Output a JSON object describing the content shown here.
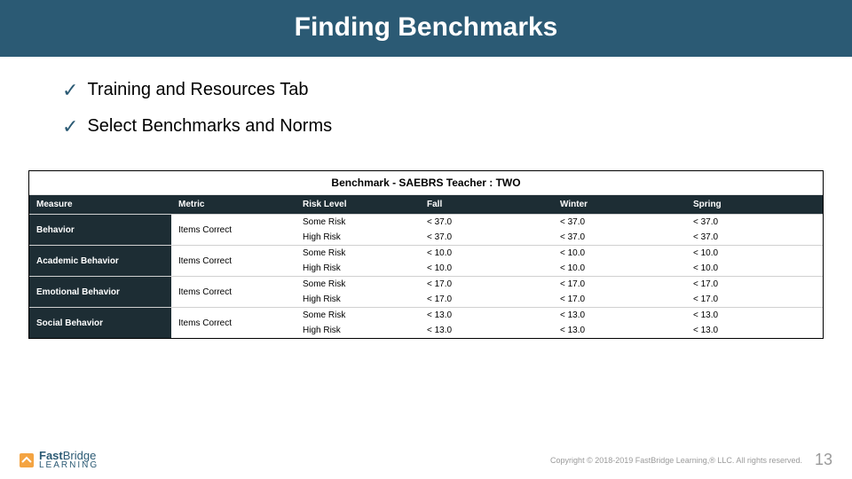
{
  "title": "Finding Benchmarks",
  "bullets": [
    "Training and Resources Tab",
    "Select Benchmarks and Norms"
  ],
  "table": {
    "title": "Benchmark - SAEBRS Teacher : TWO",
    "headers": [
      "Measure",
      "Metric",
      "Risk Level",
      "Fall",
      "Winter",
      "Spring"
    ],
    "rows": [
      {
        "measure": "Behavior",
        "metric": "Items Correct",
        "risk": [
          "Some Risk",
          "High Risk"
        ],
        "fall": [
          "< 37.0",
          "< 37.0"
        ],
        "winter": [
          "< 37.0",
          "< 37.0"
        ],
        "spring": [
          "< 37.0",
          "< 37.0"
        ]
      },
      {
        "measure": "Academic Behavior",
        "metric": "Items Correct",
        "risk": [
          "Some Risk",
          "High Risk"
        ],
        "fall": [
          "< 10.0",
          "< 10.0"
        ],
        "winter": [
          "< 10.0",
          "< 10.0"
        ],
        "spring": [
          "< 10.0",
          "< 10.0"
        ]
      },
      {
        "measure": "Emotional Behavior",
        "metric": "Items Correct",
        "risk": [
          "Some Risk",
          "High Risk"
        ],
        "fall": [
          "< 17.0",
          "< 17.0"
        ],
        "winter": [
          "< 17.0",
          "< 17.0"
        ],
        "spring": [
          "< 17.0",
          "< 17.0"
        ]
      },
      {
        "measure": "Social Behavior",
        "metric": "Items Correct",
        "risk": [
          "Some Risk",
          "High Risk"
        ],
        "fall": [
          "< 13.0",
          "< 13.0"
        ],
        "winter": [
          "< 13.0",
          "< 13.0"
        ],
        "spring": [
          "< 13.0",
          "< 13.0"
        ]
      }
    ]
  },
  "footer": {
    "logo_line1_a": "Fast",
    "logo_line1_b": "Bridge",
    "logo_line2": "Learning",
    "copyright": "Copyright © 2018-2019 FastBridge Learning,® LLC. All rights reserved.",
    "page": "13"
  }
}
